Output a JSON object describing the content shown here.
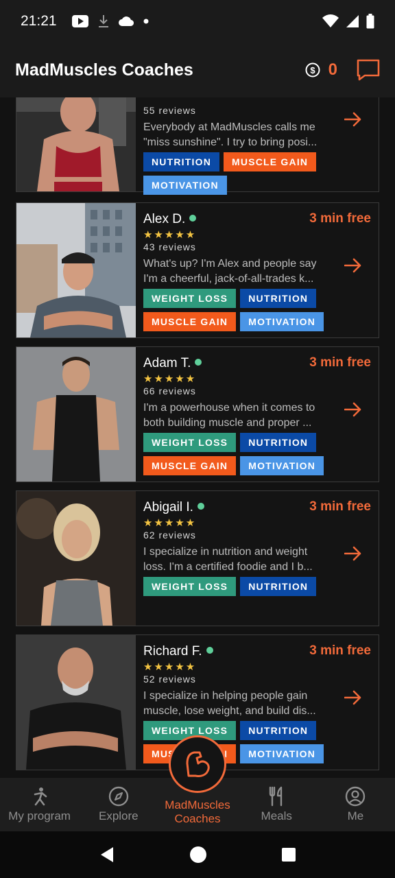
{
  "status_bar": {
    "time": "21:21"
  },
  "header": {
    "title": "MadMuscles Coaches",
    "coins": "0"
  },
  "coaches": [
    {
      "name": "",
      "online": false,
      "free": "",
      "stars": "",
      "reviews": "55 reviews",
      "bio": [
        "Everybody at MadMuscles calls me",
        "\"miss sunshine\". I try to bring posi..."
      ],
      "tags": [
        {
          "label": "NUTRITION",
          "kind": "nutrition"
        },
        {
          "label": "MUSCLE GAIN",
          "kind": "muscle"
        },
        {
          "label": "MOTIVATION",
          "kind": "motivation"
        }
      ]
    },
    {
      "name": "Alex D.",
      "online": true,
      "free": "3 min free",
      "stars": "★★★★★",
      "reviews": "43 reviews",
      "bio": [
        "What's up? I'm Alex and people say",
        "I'm a cheerful, jack-of-all-trades k..."
      ],
      "tags": [
        {
          "label": "WEIGHT LOSS",
          "kind": "weight"
        },
        {
          "label": "NUTRITION",
          "kind": "nutrition"
        },
        {
          "label": "MUSCLE GAIN",
          "kind": "muscle"
        },
        {
          "label": "MOTIVATION",
          "kind": "motivation"
        }
      ]
    },
    {
      "name": "Adam T.",
      "online": true,
      "free": "3 min free",
      "stars": "★★★★★",
      "reviews": "66 reviews",
      "bio": [
        "I'm a powerhouse when it comes to",
        "both building muscle and proper ..."
      ],
      "tags": [
        {
          "label": "WEIGHT LOSS",
          "kind": "weight"
        },
        {
          "label": "NUTRITION",
          "kind": "nutrition"
        },
        {
          "label": "MUSCLE GAIN",
          "kind": "muscle"
        },
        {
          "label": "MOTIVATION",
          "kind": "motivation"
        }
      ]
    },
    {
      "name": "Abigail I.",
      "online": true,
      "free": "3 min free",
      "stars": "★★★★★",
      "reviews": "62 reviews",
      "bio": [
        "I specialize in nutrition and weight",
        "loss. I'm a certified foodie and I b..."
      ],
      "tags": [
        {
          "label": "WEIGHT LOSS",
          "kind": "weight"
        },
        {
          "label": "NUTRITION",
          "kind": "nutrition"
        }
      ]
    },
    {
      "name": "Richard F.",
      "online": true,
      "free": "3 min free",
      "stars": "★★★★★",
      "reviews": "52 reviews",
      "bio": [
        "I specialize in helping people gain",
        "muscle, lose weight, and build dis..."
      ],
      "tags": [
        {
          "label": "WEIGHT LOSS",
          "kind": "weight"
        },
        {
          "label": "NUTRITION",
          "kind": "nutrition"
        },
        {
          "label": "MUSCLE GAIN",
          "kind": "muscle"
        },
        {
          "label": "MOTIVATION",
          "kind": "motivation"
        }
      ]
    }
  ],
  "bottom_nav": {
    "items": [
      "My program",
      "Explore",
      "MadMuscles\nCoaches",
      "Meals",
      "Me"
    ],
    "active": "MadMuscles Coaches"
  },
  "colors": {
    "accent": "#f26a3a",
    "nutrition": "#0b4aa6",
    "weight_loss": "#2f9a7d",
    "muscle_gain": "#f25a1c",
    "motivation": "#4a95e6",
    "online": "#5fcf9a",
    "stars": "#f5c542"
  }
}
